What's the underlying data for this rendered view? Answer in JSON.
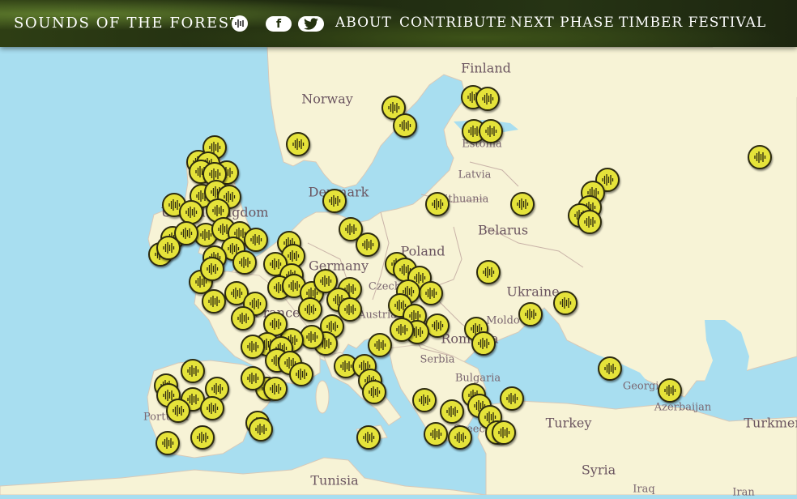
{
  "header": {
    "brand": "SOUNDS OF THE FOREST",
    "logo_icon": "sound-wave-icon",
    "social": [
      {
        "name": "facebook",
        "icon": "facebook-icon"
      },
      {
        "name": "twitter",
        "icon": "twitter-icon"
      }
    ],
    "nav": [
      "ABOUT",
      "CONTRIBUTE",
      "NEXT PHASE",
      "TIMBER FESTIVAL"
    ]
  },
  "colors": {
    "sea": "#a8def0",
    "land": "#f7f3d6",
    "marker": "#e5e33a",
    "marker_border": "#2c2a10",
    "header": "#24320f"
  },
  "map_labels": [
    {
      "text": "Finland",
      "big": true
    },
    {
      "text": "Norway",
      "big": true
    },
    {
      "text": "Estonia",
      "big": false
    },
    {
      "text": "Latvia",
      "big": false
    },
    {
      "text": "Lithuania",
      "big": false
    },
    {
      "text": "Denmark",
      "big": true
    },
    {
      "text": "Belarus",
      "big": true
    },
    {
      "text": "Poland",
      "big": true
    },
    {
      "text": "Germany",
      "big": true
    },
    {
      "text": "Czech",
      "big": false
    },
    {
      "text": "Austria",
      "big": false
    },
    {
      "text": "Ukraine",
      "big": true
    },
    {
      "text": "Moldo",
      "big": false
    },
    {
      "text": "Romania",
      "big": true
    },
    {
      "text": "Serbia",
      "big": false
    },
    {
      "text": "Bulgaria",
      "big": false
    },
    {
      "text": "Georgia",
      "big": false
    },
    {
      "text": "Azerbaijan",
      "big": false
    },
    {
      "text": "Turkey",
      "big": true
    },
    {
      "text": "Turkmen",
      "big": true
    },
    {
      "text": "Syria",
      "big": true
    },
    {
      "text": "Iraq",
      "big": false
    },
    {
      "text": "Iran",
      "big": false
    },
    {
      "text": "Tunisia",
      "big": true
    },
    {
      "text": "Portugal",
      "big": false
    },
    {
      "text": "France",
      "big": true
    },
    {
      "text": "United Kingdom",
      "big": true
    },
    {
      "text": "Greece",
      "big": false
    }
  ],
  "marker_icon": "sound-wave-icon"
}
